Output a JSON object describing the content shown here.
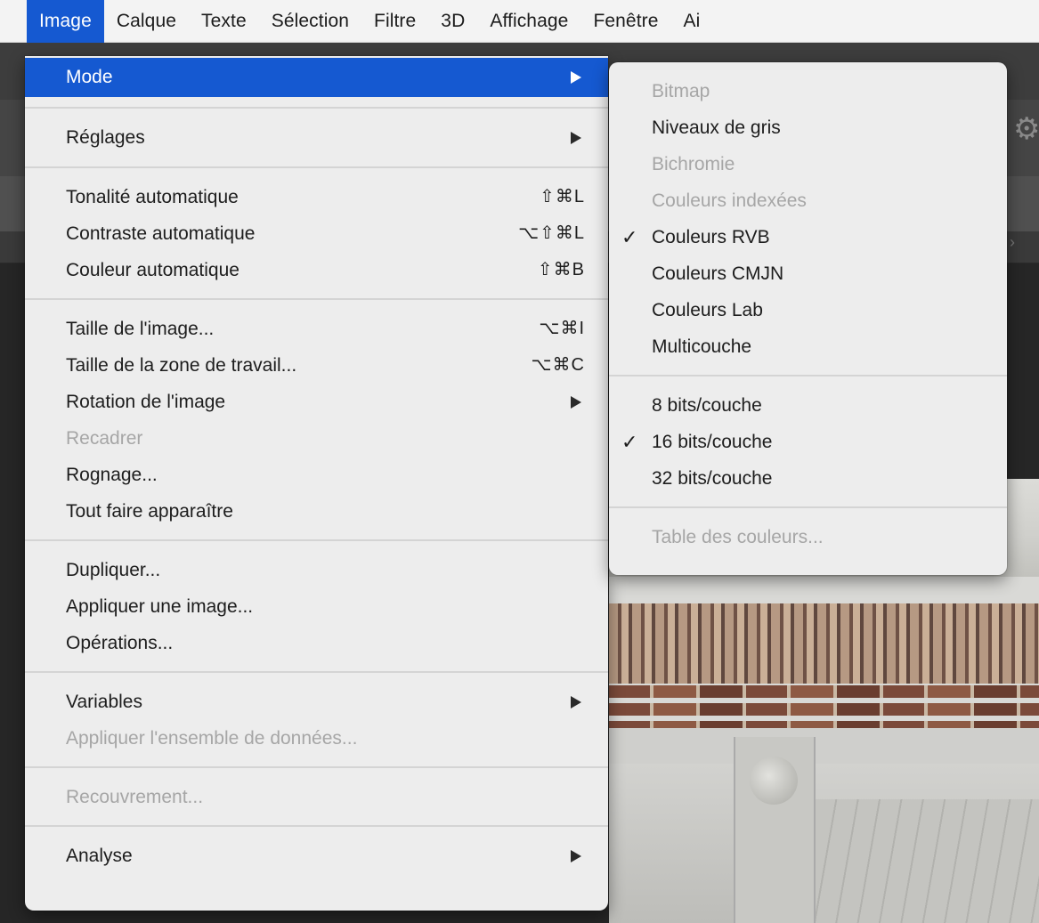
{
  "menubar": {
    "items": [
      {
        "label": "Image",
        "active": true
      },
      {
        "label": "Calque"
      },
      {
        "label": "Texte"
      },
      {
        "label": "Sélection"
      },
      {
        "label": "Filtre"
      },
      {
        "label": "3D"
      },
      {
        "label": "Affichage"
      },
      {
        "label": "Fenêtre"
      },
      {
        "label": "Ai"
      }
    ]
  },
  "image_menu": {
    "mode": {
      "label": "Mode"
    },
    "reglages": {
      "label": "Réglages"
    },
    "tonalite": {
      "label": "Tonalité automatique",
      "shortcut": "⇧⌘L"
    },
    "contraste": {
      "label": "Contraste automatique",
      "shortcut": "⌥⇧⌘L"
    },
    "couleur": {
      "label": "Couleur automatique",
      "shortcut": "⇧⌘B"
    },
    "taille_image": {
      "label": "Taille de l'image...",
      "shortcut": "⌥⌘I"
    },
    "taille_zone": {
      "label": "Taille de la zone de travail...",
      "shortcut": "⌥⌘C"
    },
    "rotation": {
      "label": "Rotation de l'image"
    },
    "recadrer": {
      "label": "Recadrer"
    },
    "rognage": {
      "label": "Rognage..."
    },
    "tout_faire": {
      "label": "Tout faire apparaître"
    },
    "dupliquer": {
      "label": "Dupliquer..."
    },
    "appliquer_image": {
      "label": "Appliquer une image..."
    },
    "operations": {
      "label": "Opérations..."
    },
    "variables": {
      "label": "Variables"
    },
    "appliquer_donnees": {
      "label": "Appliquer l'ensemble de données..."
    },
    "recouvrement": {
      "label": "Recouvrement..."
    },
    "analyse": {
      "label": "Analyse"
    }
  },
  "mode_submenu": {
    "bitmap": {
      "label": "Bitmap"
    },
    "gris": {
      "label": "Niveaux de gris"
    },
    "bichromie": {
      "label": "Bichromie"
    },
    "indexees": {
      "label": "Couleurs indexées"
    },
    "rvb": {
      "label": "Couleurs RVB",
      "check": "✓"
    },
    "cmjn": {
      "label": "Couleurs CMJN"
    },
    "lab": {
      "label": "Couleurs Lab"
    },
    "multicouche": {
      "label": "Multicouche"
    },
    "bits8": {
      "label": "8 bits/couche"
    },
    "bits16": {
      "label": "16 bits/couche",
      "check": "✓"
    },
    "bits32": {
      "label": "32 bits/couche"
    },
    "table": {
      "label": "Table des couleurs..."
    }
  },
  "colors": {
    "highlight": "#1559d1",
    "menu_bg": "#ededed",
    "disabled_text": "#a6a6a6"
  }
}
